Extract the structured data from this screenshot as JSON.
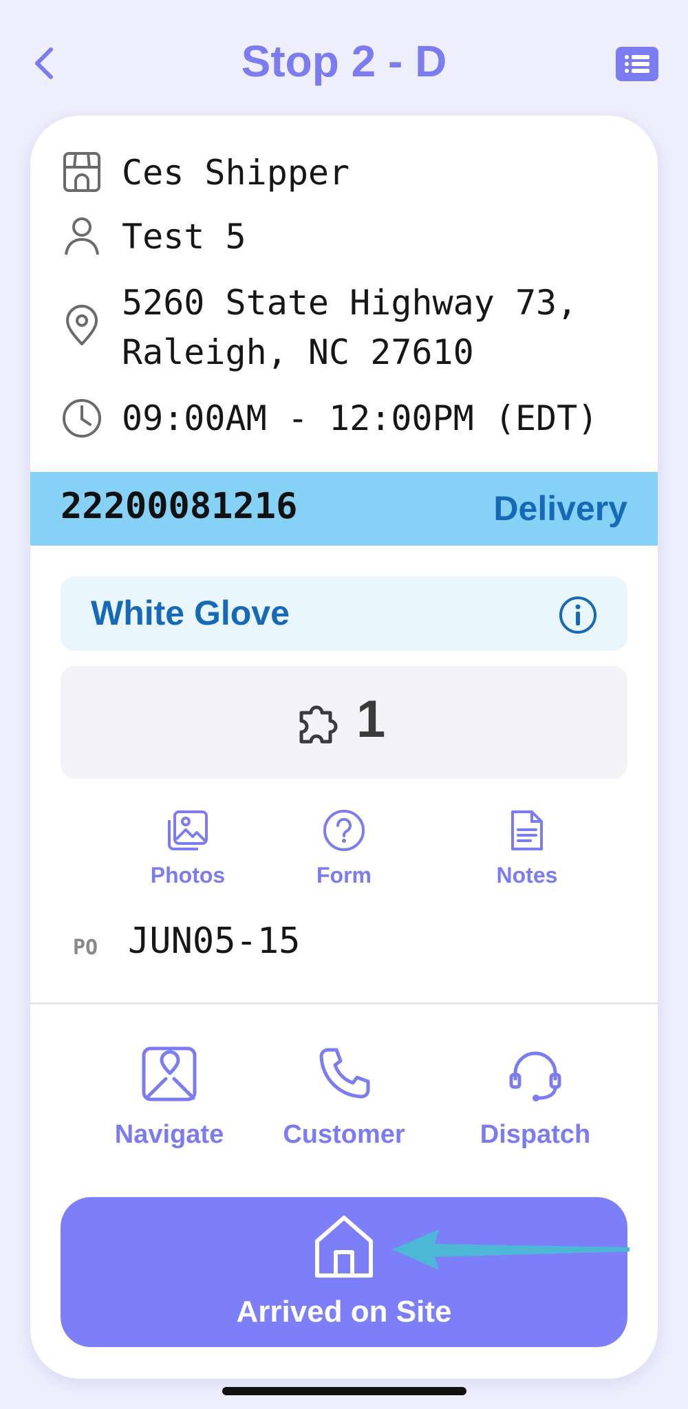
{
  "header": {
    "title": "Stop 2 - D",
    "back_icon": "chevron-left-icon",
    "menu_icon": "list-icon"
  },
  "stop": {
    "shipper": "Ces Shipper",
    "contact": "Test 5",
    "address": "5260 State Highway 73, Raleigh, NC 27610",
    "time_window": "09:00AM - 12:00PM (EDT)"
  },
  "order": {
    "number": "22200081216",
    "type": "Delivery"
  },
  "service": {
    "label": "White Glove"
  },
  "pieces": {
    "count": "1"
  },
  "quick_actions": {
    "photos": "Photos",
    "form": "Form",
    "notes": "Notes"
  },
  "po": {
    "label": "PO",
    "value": "JUN05-15"
  },
  "contact_actions": {
    "navigate": "Navigate",
    "customer": "Customer",
    "dispatch": "Dispatch"
  },
  "primary_action": {
    "label": "Arrived on Site"
  },
  "colors": {
    "accent": "#7c7cf2",
    "order_bar": "#86d2f6",
    "order_type": "#1669b8",
    "annotation_arrow": "#4db8d6"
  }
}
